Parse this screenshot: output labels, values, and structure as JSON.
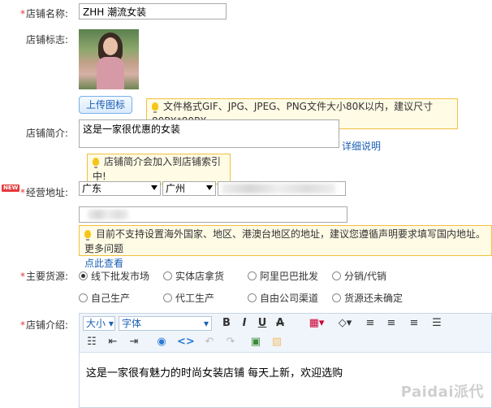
{
  "store_name": {
    "label": "*店铺名称:",
    "value": "ZHH 潮流女装"
  },
  "store_logo": {
    "label": "店铺标志:",
    "upload_button": "上传图标",
    "tip": "文件格式GIF、JPG、JPEG、PNG文件大小80K以内，建议尺寸80PX*80PX"
  },
  "store_intro_short": {
    "label": "店铺简介:",
    "value": "这是一家很优惠的女装",
    "detail_link": "详细说明",
    "tip": "店铺简介会加入到店铺索引中!"
  },
  "address": {
    "badge": "NEW",
    "label": "*经营地址:",
    "province": "广东",
    "city": "广州",
    "tip_line1": "目前不支持设置海外国家、地区、港澳台地区的地址，建议您遵循声明要求填写国内地址。更多问题",
    "tip_link": "点此查看"
  },
  "supply": {
    "label": "*主要货源:",
    "options": [
      "线下批发市场",
      "实体店拿货",
      "阿里巴巴批发",
      "分销/代销",
      "自己生产",
      "代工生产",
      "自由公司渠道",
      "货源还未确定"
    ],
    "selected": 0
  },
  "shop_desc": {
    "label": "*店铺介绍:",
    "toolbar": {
      "size": "大小",
      "font": "字体"
    },
    "content": "这是一家很有魅力的时尚女装店铺 每天上新，欢迎选购"
  },
  "watermark": "Paidai派代"
}
